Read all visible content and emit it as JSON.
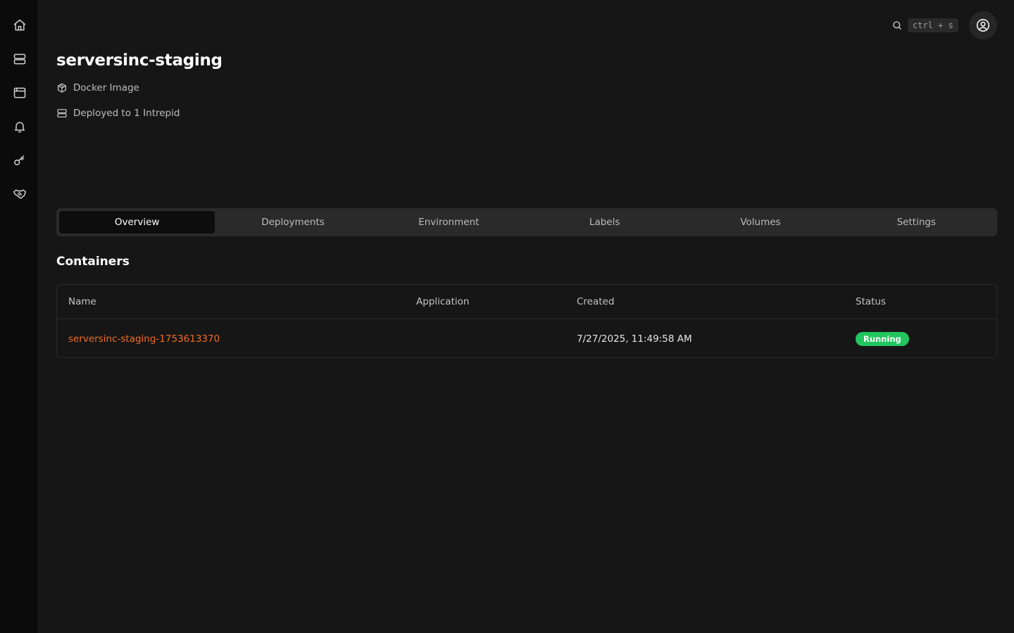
{
  "sidebar": {
    "items": [
      {
        "name": "home",
        "icon": "home-icon"
      },
      {
        "name": "servers",
        "icon": "server-icon"
      },
      {
        "name": "apps",
        "icon": "browser-window-icon"
      },
      {
        "name": "notifications",
        "icon": "bell-icon"
      },
      {
        "name": "keys",
        "icon": "key-icon"
      },
      {
        "name": "partners",
        "icon": "handshake-icon"
      }
    ]
  },
  "header": {
    "search_icon": "search-icon",
    "shortcut": "ctrl + s",
    "avatar_icon": "user-circle-icon"
  },
  "app": {
    "title": "serversinc-staging",
    "source_label": "Docker Image",
    "deployed_label": "Deployed to 1 Intrepid"
  },
  "tabs": [
    {
      "label": "Overview",
      "active": true
    },
    {
      "label": "Deployments",
      "active": false
    },
    {
      "label": "Environment",
      "active": false
    },
    {
      "label": "Labels",
      "active": false
    },
    {
      "label": "Volumes",
      "active": false
    },
    {
      "label": "Settings",
      "active": false
    }
  ],
  "containers": {
    "title": "Containers",
    "columns": [
      "Name",
      "Application",
      "Created",
      "Status"
    ],
    "rows": [
      {
        "name": "serversinc-staging-1753613370",
        "application": "",
        "created": "7/27/2025, 11:49:58 AM",
        "status": "Running"
      }
    ]
  },
  "colors": {
    "accent": "#f26b22",
    "status_running": "#22c55e",
    "background": "#161616",
    "sidebar": "#0b0b0b"
  }
}
